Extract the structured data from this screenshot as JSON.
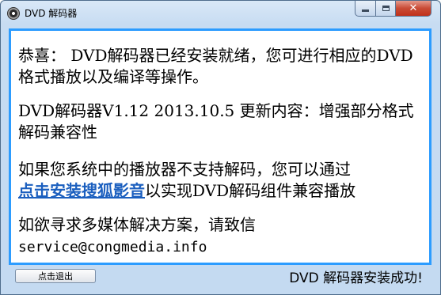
{
  "window": {
    "title": "DVD 解码器",
    "minimize_icon": "minimize-icon",
    "maximize_icon": "maximize-icon",
    "close_icon": "close-icon",
    "accent_color": "#2c9cff"
  },
  "content": {
    "p1": "恭喜： DVD解码器已经安装就绪，您可进行相应的DVD格式播放以及编译等操作。",
    "p2": "DVD解码器V1.12 2013.10.5 更新内容：增强部分格式解码兼容性",
    "p3_before": "如果您系统中的播放器不支持解码，您可以通过",
    "p3_link": "点击安装搜狐影音",
    "p3_after": "以实现DVD解码组件兼容播放",
    "p4_text": "如欲寻求多媒体解决方案，请致信",
    "p4_email": "service@congmedia.info"
  },
  "footer": {
    "exit_label": "点击退出",
    "status": "DVD 解码器安装成功!"
  }
}
